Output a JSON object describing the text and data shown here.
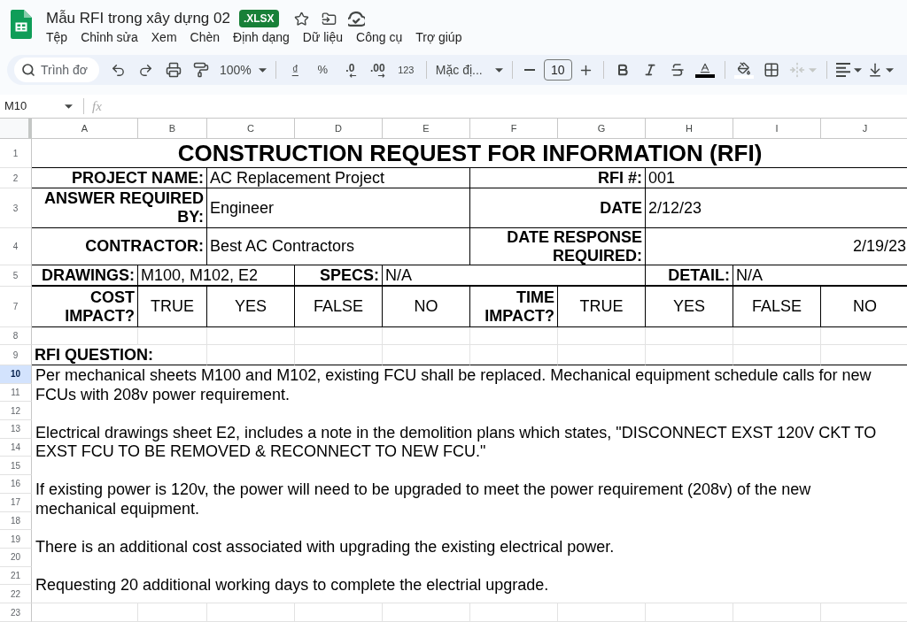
{
  "document": {
    "title": "Mẫu RFI trong xây dựng 02",
    "badge": ".XLSX"
  },
  "menu": [
    "Tệp",
    "Chỉnh sửa",
    "Xem",
    "Chèn",
    "Định dạng",
    "Dữ liệu",
    "Công cụ",
    "Trợ giúp"
  ],
  "toolbar": {
    "search": {
      "placeholder": "Trình đơ"
    },
    "zoom": "100%",
    "currency": "₫",
    "percent": "%",
    "decrease_decimal": ".0",
    "increase_decimal": ".00",
    "number_format": "123",
    "font": "Mặc đị...",
    "font_size": "10",
    "merge": {
      "disabled": true
    }
  },
  "formula_bar": {
    "cell_ref": "M10",
    "label": "fx"
  },
  "columns": [
    {
      "label": "A",
      "selected": false
    },
    {
      "label": "B",
      "selected": false
    },
    {
      "label": "C",
      "selected": false
    },
    {
      "label": "D",
      "selected": false
    },
    {
      "label": "E",
      "selected": false
    },
    {
      "label": "F",
      "selected": false
    },
    {
      "label": "G",
      "selected": false
    },
    {
      "label": "H",
      "selected": false
    },
    {
      "label": "I",
      "selected": false
    },
    {
      "label": "J",
      "selected": false
    }
  ],
  "rows": [
    {
      "label": "1",
      "selected": false
    },
    {
      "label": "2",
      "selected": false
    },
    {
      "label": "3",
      "selected": false
    },
    {
      "label": "4",
      "selected": false
    },
    {
      "label": "5",
      "selected": false
    },
    {
      "label": "7",
      "selected": false
    },
    {
      "label": "8",
      "selected": false
    },
    {
      "label": "9",
      "selected": false
    },
    {
      "label": "10",
      "selected": true
    },
    {
      "label": "11",
      "selected": false
    },
    {
      "label": "12",
      "selected": false
    },
    {
      "label": "13",
      "selected": false
    },
    {
      "label": "14",
      "selected": false
    },
    {
      "label": "15",
      "selected": false
    },
    {
      "label": "16",
      "selected": false
    },
    {
      "label": "17",
      "selected": false
    },
    {
      "label": "18",
      "selected": false
    },
    {
      "label": "19",
      "selected": false
    },
    {
      "label": "20",
      "selected": false
    },
    {
      "label": "21",
      "selected": false
    },
    {
      "label": "22",
      "selected": false
    },
    {
      "label": "23",
      "selected": false
    }
  ],
  "form": {
    "title": "CONSTRUCTION REQUEST FOR INFORMATION (RFI)",
    "project_name": {
      "label": "PROJECT NAME:",
      "value": "AC Replacement Project"
    },
    "rfi_number": {
      "label": "RFI #:",
      "value": "001"
    },
    "answer_required_by": {
      "label": "ANSWER REQUIRED BY:",
      "value": "Engineer"
    },
    "date": {
      "label": "DATE",
      "value": "2/12/23"
    },
    "contractor": {
      "label": "CONTRACTOR:",
      "value": "Best AC Contractors"
    },
    "date_response_required": {
      "label": "DATE RESPONSE REQUIRED:",
      "value": "2/19/23"
    },
    "drawings": {
      "label": "DRAWINGS:",
      "value": "M100, M102, E2"
    },
    "specs": {
      "label": "SPECS:",
      "value": "N/A"
    },
    "detail": {
      "label": "DETAIL:",
      "value": "N/A"
    },
    "impacts": [
      {
        "label": "COST IMPACT?",
        "options": [
          "TRUE",
          "YES",
          "FALSE",
          "NO"
        ]
      },
      {
        "label": "TIME IMPACT?",
        "options": [
          "TRUE",
          "YES",
          "FALSE",
          "NO"
        ]
      }
    ],
    "question": {
      "label": "RFI QUESTION:",
      "paragraphs": [
        "Per mechanical sheets M100 and M102, existing FCU shall be replaced. Mechanical equipment schedule calls for new FCUs with 208v power requirement.",
        "Electrical drawings sheet E2, includes a note in the demolition plans which states, \"DISCONNECT EXST 120V CKT TO EXST FCU TO BE REMOVED & RECONNECT TO NEW FCU.\"",
        "If existing power is 120v, the power will need to be upgraded to meet the power requirement (208v) of the new mechanical equipment.",
        "There is an additional cost associated with upgrading the existing electrical power.",
        "Requesting 20 additional working days to complete the electrial upgrade."
      ]
    }
  }
}
